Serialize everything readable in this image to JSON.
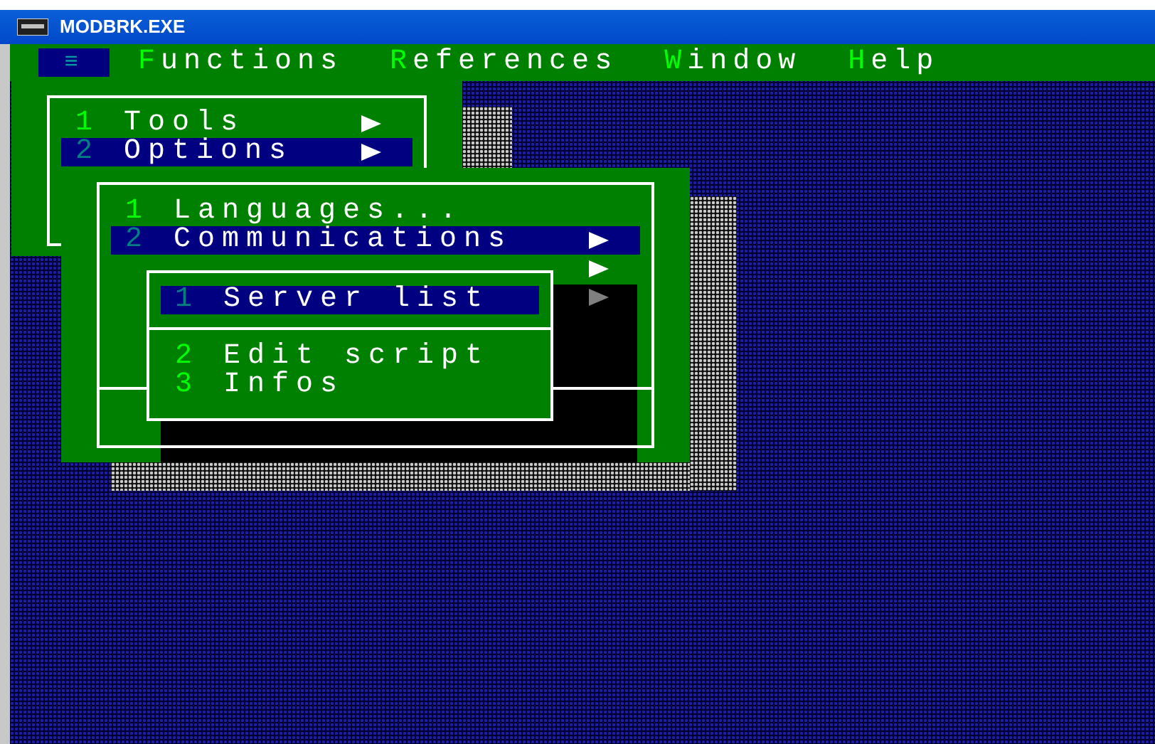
{
  "window": {
    "title": "MODBRK.EXE"
  },
  "menu_bar": {
    "system_menu": {
      "label": "≡",
      "selected": true
    },
    "items": [
      {
        "hotkey": "F",
        "rest": "unctions"
      },
      {
        "hotkey": "R",
        "rest": "eferences"
      },
      {
        "hotkey": "W",
        "rest": "indow"
      },
      {
        "hotkey": "H",
        "rest": "elp"
      }
    ]
  },
  "menus": [
    {
      "items": [
        {
          "kind": "item",
          "number": "1",
          "label": "Tools",
          "submenu": true,
          "selected": false
        },
        {
          "kind": "item",
          "number": "2",
          "label": "Options",
          "submenu": true,
          "selected": true
        }
      ]
    },
    {
      "items": [
        {
          "kind": "item",
          "number": "1",
          "label": "Languages...",
          "submenu": false,
          "selected": false
        },
        {
          "kind": "item",
          "number": "2",
          "label": "Communications",
          "submenu": true,
          "selected": true
        },
        {
          "kind": "covered",
          "submenu": true,
          "disabled": false
        },
        {
          "kind": "covered",
          "submenu": true,
          "disabled": true
        }
      ]
    },
    {
      "items": [
        {
          "kind": "item",
          "number": "1",
          "label": "Server list",
          "submenu": false,
          "selected": true
        },
        {
          "kind": "separator"
        },
        {
          "kind": "item",
          "number": "2",
          "label": "Edit script",
          "submenu": false,
          "selected": false
        },
        {
          "kind": "item",
          "number": "3",
          "label": "Infos",
          "submenu": false,
          "selected": false
        }
      ]
    }
  ]
}
